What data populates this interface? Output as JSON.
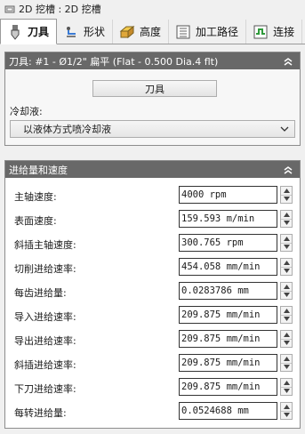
{
  "title_bar": {
    "text": "2D 挖槽 : 2D 挖槽"
  },
  "tabs": [
    {
      "label": "刀具",
      "icon": "tool-icon",
      "active": true
    },
    {
      "label": "形状",
      "icon": "shape-icon",
      "active": false
    },
    {
      "label": "高度",
      "icon": "height-icon",
      "active": false
    },
    {
      "label": "加工路径",
      "icon": "toolpath-icon",
      "active": false
    },
    {
      "label": "连接",
      "icon": "link-icon",
      "active": false
    }
  ],
  "tool_panel": {
    "header": "刀具: #1 - Ø1/2\" 扁平 (Flat - 0.500 Dia.4 flt)",
    "tool_button": "刀具",
    "coolant_label": "冷却液:",
    "coolant_value": "以液体方式喷冷却液"
  },
  "feeds_panel": {
    "header": "进给量和速度",
    "rows": [
      {
        "label": "主轴速度:",
        "value": "4000 rpm"
      },
      {
        "label": "表面速度:",
        "value": "159.593 m/min"
      },
      {
        "label": "斜插主轴速度:",
        "value": "300.765 rpm"
      },
      {
        "label": "切削进给速率:",
        "value": "454.058 mm/min"
      },
      {
        "label": "每齿进给量:",
        "value": "0.0283786 mm"
      },
      {
        "label": "导入进给速率:",
        "value": "209.875 mm/min"
      },
      {
        "label": "导出进给速率:",
        "value": "209.875 mm/min"
      },
      {
        "label": "斜插进给速率:",
        "value": "209.875 mm/min"
      },
      {
        "label": "下刀进给速率:",
        "value": "209.875 mm/min"
      },
      {
        "label": "每转进给量:",
        "value": "0.0524688 mm"
      }
    ]
  },
  "colors": {
    "panel_header": "#686868",
    "background": "#f0f0f0"
  }
}
